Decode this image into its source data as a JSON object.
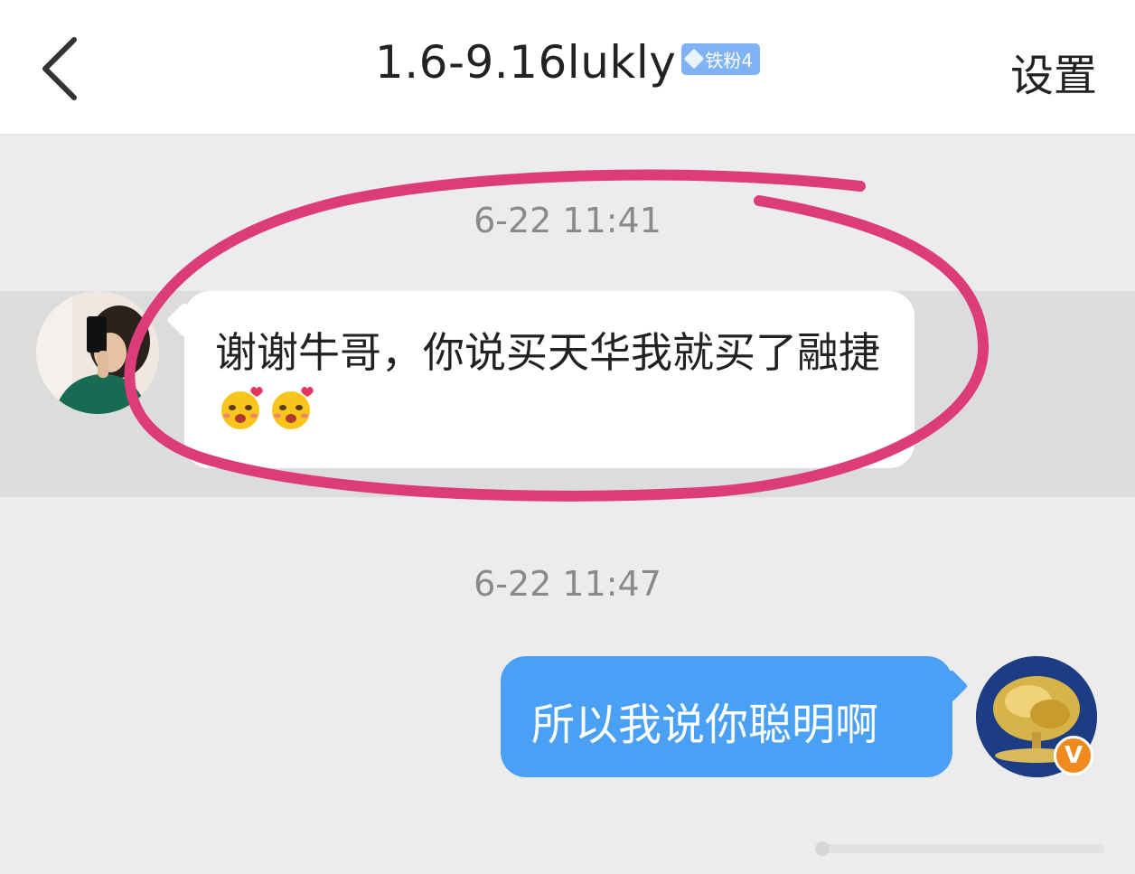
{
  "header": {
    "back_icon": "chevron-left-icon",
    "title": "1.6-9.16lukly",
    "fan_badge": "铁粉4",
    "settings_label": "设置"
  },
  "messages": [
    {
      "timestamp": "6-22 11:41",
      "direction": "incoming",
      "text": "谢谢牛哥，你说买天华我就买了融捷",
      "emoji": [
        "blushing-heart-emoji",
        "blushing-heart-emoji"
      ]
    },
    {
      "timestamp": "6-22 11:47",
      "direction": "outgoing",
      "text": "所以我说你聪明啊",
      "verified_badge": "V"
    }
  ],
  "colors": {
    "background": "#ececec",
    "highlight_row": "#dcdcdc",
    "outgoing_bubble": "#4aa0f5",
    "annotation_circle": "#dc3c78",
    "verified_badge": "#f08a1c"
  }
}
